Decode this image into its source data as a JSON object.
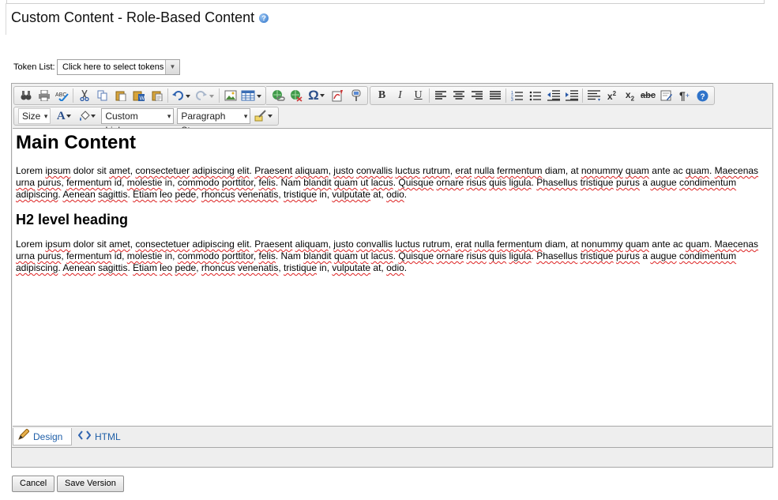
{
  "page": {
    "title": "Custom Content - Role-Based Content",
    "help_icon": "?"
  },
  "token_list": {
    "label": "Token List:",
    "value": "Click here to select tokens"
  },
  "toolbar": {
    "row1_icons": [
      "find-replace-icon",
      "print-icon",
      "spellcheck-icon",
      "cut-icon",
      "copy-icon",
      "paste-icon",
      "paste-word-icon",
      "paste-plain-icon",
      "undo-icon",
      "redo-icon",
      "image-manager-icon",
      "table-icon",
      "hyperlink-icon",
      "remove-link-icon",
      "symbol-icon",
      "flash-icon",
      "media-icon",
      "bold-icon",
      "italic-icon",
      "underline-icon",
      "align-left-icon",
      "align-center-icon",
      "align-right-icon",
      "justify-icon",
      "numbered-list-icon",
      "bulleted-list-icon",
      "outdent-icon",
      "indent-icon",
      "paragraph-format-icon",
      "superscript-icon",
      "subscript-icon",
      "strikethrough-icon",
      "template-icon",
      "show-paragraph-icon",
      "help-icon"
    ],
    "size_label": "Size",
    "custom_links_label": "Custom Links",
    "paragraph_style_label": "Paragraph St..."
  },
  "content": {
    "h1": "Main Content",
    "p1_plain": "Lorem ipsum dolor sit amet, consectetuer adipiscing elit. Praesent aliquam, justo convallis luctus rutrum, erat nulla fermentum diam, at nonummy quam ante ac quam. Maecenas urna purus, fermentum id, molestie in, commodo porttitor, felis. Nam blandit quam ut lacus. Quisque ornare risus quis ligula. Phasellus tristique purus a augue condimentum adipiscing. Aenean sagittis. Etiam leo pede, rhoncus venenatis, tristique in, vulputate at, odio.",
    "h2": "H2 level heading",
    "p2_plain": "Lorem ipsum dolor sit amet, consectetuer adipiscing elit. Praesent aliquam, justo convallis luctus rutrum, erat nulla fermentum diam, at nonummy quam ante ac quam. Maecenas urna purus, fermentum id, molestie in, commodo porttitor, felis. Nam blandit quam ut lacus. Quisque ornare risus quis ligula. Phasellus tristique purus a augue condimentum adipiscing. Aenean sagittis. Etiam leo pede, rhoncus venenatis, tristique in, vulputate at, odio."
  },
  "modes": {
    "design_label": "Design",
    "html_label": "HTML"
  },
  "buttons": {
    "cancel": "Cancel",
    "save_version": "Save Version"
  },
  "colors": {
    "link_blue": "#1f5fa8",
    "spellcheck_red": "#dd2222"
  }
}
